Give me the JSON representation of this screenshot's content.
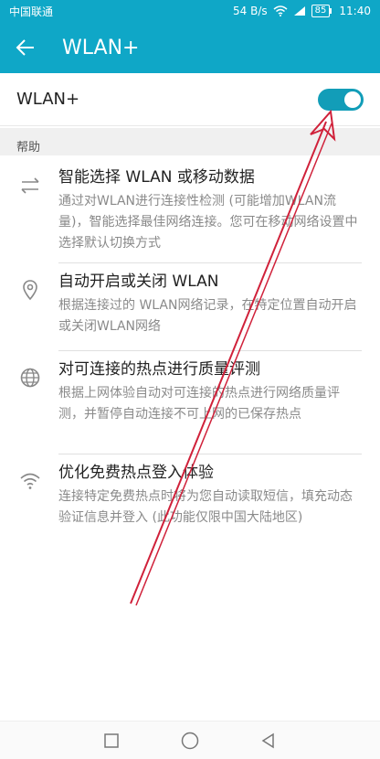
{
  "status": {
    "carrier": "中国联通",
    "speed": "54 B/s",
    "battery": "85",
    "time": "11:40"
  },
  "appbar": {
    "title": "WLAN+"
  },
  "wlan_plus": {
    "label": "WLAN+",
    "enabled": true
  },
  "section": {
    "title": "帮助"
  },
  "items": [
    {
      "title": "智能选择 WLAN 或移动数据",
      "desc": "通过对WLAN进行连接性检测 (可能增加WLAN流量)，智能选择最佳网络连接。您可在移动网络设置中选择默认切换方式",
      "icon": "swap-arrows-icon"
    },
    {
      "title": "自动开启或关闭 WLAN",
      "desc": "根据连接过的 WLAN网络记录，在特定位置自动开启或关闭WLAN网络",
      "icon": "location-pin-icon"
    },
    {
      "title": "对可连接的热点进行质量评测",
      "desc": "根据上网体验自动对可连接的热点进行网络质量评测，并暂停自动连接不可上网的已保存热点",
      "icon": "globe-icon"
    },
    {
      "title": "优化免费热点登入体验",
      "desc": "连接特定免费热点时将为您自动读取短信，填充动态验证信息并登入 (此功能仅限中国大陆地区)",
      "icon": "wifi-icon"
    }
  ],
  "colors": {
    "accent": "#0fa7c7",
    "switch_on": "#129db8",
    "annotation": "#d0213a"
  }
}
